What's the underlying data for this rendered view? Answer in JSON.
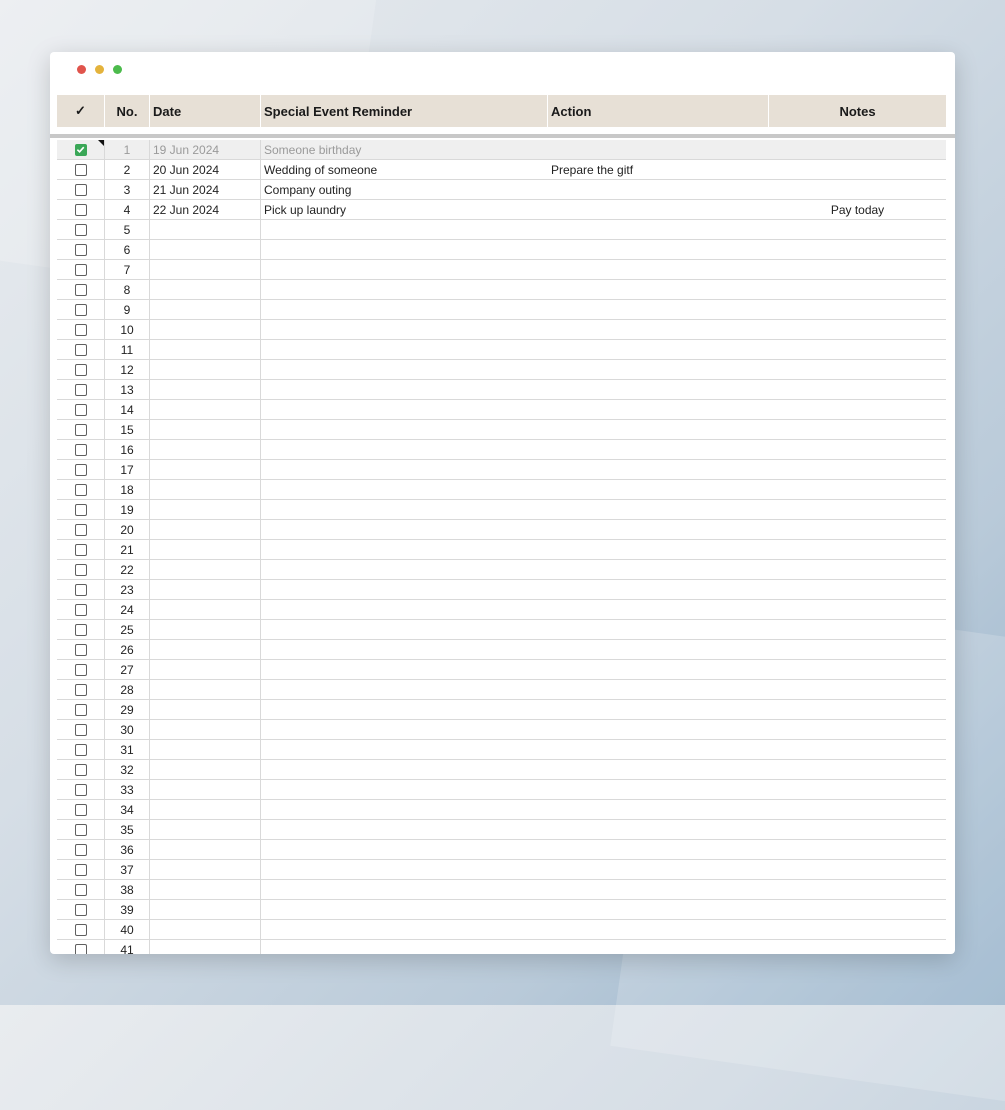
{
  "table": {
    "headers": {
      "check_symbol": "✓",
      "no": "No.",
      "date": "Date",
      "event": "Special Event Reminder",
      "action": "Action",
      "notes": "Notes"
    },
    "rows": [
      {
        "no": "1",
        "checked": true,
        "date": "19 Jun 2024",
        "event": "Someone birthday",
        "action": "",
        "notes": ""
      },
      {
        "no": "2",
        "checked": false,
        "date": "20 Jun 2024",
        "event": "Wedding of someone",
        "action": "Prepare the gitf",
        "notes": ""
      },
      {
        "no": "3",
        "checked": false,
        "date": "21 Jun 2024",
        "event": "Company outing",
        "action": "",
        "notes": ""
      },
      {
        "no": "4",
        "checked": false,
        "date": "22 Jun 2024",
        "event": "Pick up laundry",
        "action": "",
        "notes": "Pay today"
      },
      {
        "no": "5",
        "checked": false,
        "date": "",
        "event": "",
        "action": "",
        "notes": ""
      },
      {
        "no": "6",
        "checked": false,
        "date": "",
        "event": "",
        "action": "",
        "notes": ""
      },
      {
        "no": "7",
        "checked": false,
        "date": "",
        "event": "",
        "action": "",
        "notes": ""
      },
      {
        "no": "8",
        "checked": false,
        "date": "",
        "event": "",
        "action": "",
        "notes": ""
      },
      {
        "no": "9",
        "checked": false,
        "date": "",
        "event": "",
        "action": "",
        "notes": ""
      },
      {
        "no": "10",
        "checked": false,
        "date": "",
        "event": "",
        "action": "",
        "notes": ""
      },
      {
        "no": "11",
        "checked": false,
        "date": "",
        "event": "",
        "action": "",
        "notes": ""
      },
      {
        "no": "12",
        "checked": false,
        "date": "",
        "event": "",
        "action": "",
        "notes": ""
      },
      {
        "no": "13",
        "checked": false,
        "date": "",
        "event": "",
        "action": "",
        "notes": ""
      },
      {
        "no": "14",
        "checked": false,
        "date": "",
        "event": "",
        "action": "",
        "notes": ""
      },
      {
        "no": "15",
        "checked": false,
        "date": "",
        "event": "",
        "action": "",
        "notes": ""
      },
      {
        "no": "16",
        "checked": false,
        "date": "",
        "event": "",
        "action": "",
        "notes": ""
      },
      {
        "no": "17",
        "checked": false,
        "date": "",
        "event": "",
        "action": "",
        "notes": ""
      },
      {
        "no": "18",
        "checked": false,
        "date": "",
        "event": "",
        "action": "",
        "notes": ""
      },
      {
        "no": "19",
        "checked": false,
        "date": "",
        "event": "",
        "action": "",
        "notes": ""
      },
      {
        "no": "20",
        "checked": false,
        "date": "",
        "event": "",
        "action": "",
        "notes": ""
      },
      {
        "no": "21",
        "checked": false,
        "date": "",
        "event": "",
        "action": "",
        "notes": ""
      },
      {
        "no": "22",
        "checked": false,
        "date": "",
        "event": "",
        "action": "",
        "notes": ""
      },
      {
        "no": "23",
        "checked": false,
        "date": "",
        "event": "",
        "action": "",
        "notes": ""
      },
      {
        "no": "24",
        "checked": false,
        "date": "",
        "event": "",
        "action": "",
        "notes": ""
      },
      {
        "no": "25",
        "checked": false,
        "date": "",
        "event": "",
        "action": "",
        "notes": ""
      },
      {
        "no": "26",
        "checked": false,
        "date": "",
        "event": "",
        "action": "",
        "notes": ""
      },
      {
        "no": "27",
        "checked": false,
        "date": "",
        "event": "",
        "action": "",
        "notes": ""
      },
      {
        "no": "28",
        "checked": false,
        "date": "",
        "event": "",
        "action": "",
        "notes": ""
      },
      {
        "no": "29",
        "checked": false,
        "date": "",
        "event": "",
        "action": "",
        "notes": ""
      },
      {
        "no": "30",
        "checked": false,
        "date": "",
        "event": "",
        "action": "",
        "notes": ""
      },
      {
        "no": "31",
        "checked": false,
        "date": "",
        "event": "",
        "action": "",
        "notes": ""
      },
      {
        "no": "32",
        "checked": false,
        "date": "",
        "event": "",
        "action": "",
        "notes": ""
      },
      {
        "no": "33",
        "checked": false,
        "date": "",
        "event": "",
        "action": "",
        "notes": ""
      },
      {
        "no": "34",
        "checked": false,
        "date": "",
        "event": "",
        "action": "",
        "notes": ""
      },
      {
        "no": "35",
        "checked": false,
        "date": "",
        "event": "",
        "action": "",
        "notes": ""
      },
      {
        "no": "36",
        "checked": false,
        "date": "",
        "event": "",
        "action": "",
        "notes": ""
      },
      {
        "no": "37",
        "checked": false,
        "date": "",
        "event": "",
        "action": "",
        "notes": ""
      },
      {
        "no": "38",
        "checked": false,
        "date": "",
        "event": "",
        "action": "",
        "notes": ""
      },
      {
        "no": "39",
        "checked": false,
        "date": "",
        "event": "",
        "action": "",
        "notes": ""
      },
      {
        "no": "40",
        "checked": false,
        "date": "",
        "event": "",
        "action": "",
        "notes": ""
      },
      {
        "no": "41",
        "checked": false,
        "date": "",
        "event": "",
        "action": "",
        "notes": ""
      }
    ]
  },
  "colors": {
    "header_bg": "#e7e0d6",
    "checked_green": "#3aa757",
    "done_row_bg": "#efefef"
  },
  "icons": {
    "window_close": "close-dot-icon",
    "window_minimize": "minimize-dot-icon",
    "window_zoom": "zoom-dot-icon",
    "checkbox": "checkbox-icon",
    "checkmark": "checkmark-icon"
  }
}
